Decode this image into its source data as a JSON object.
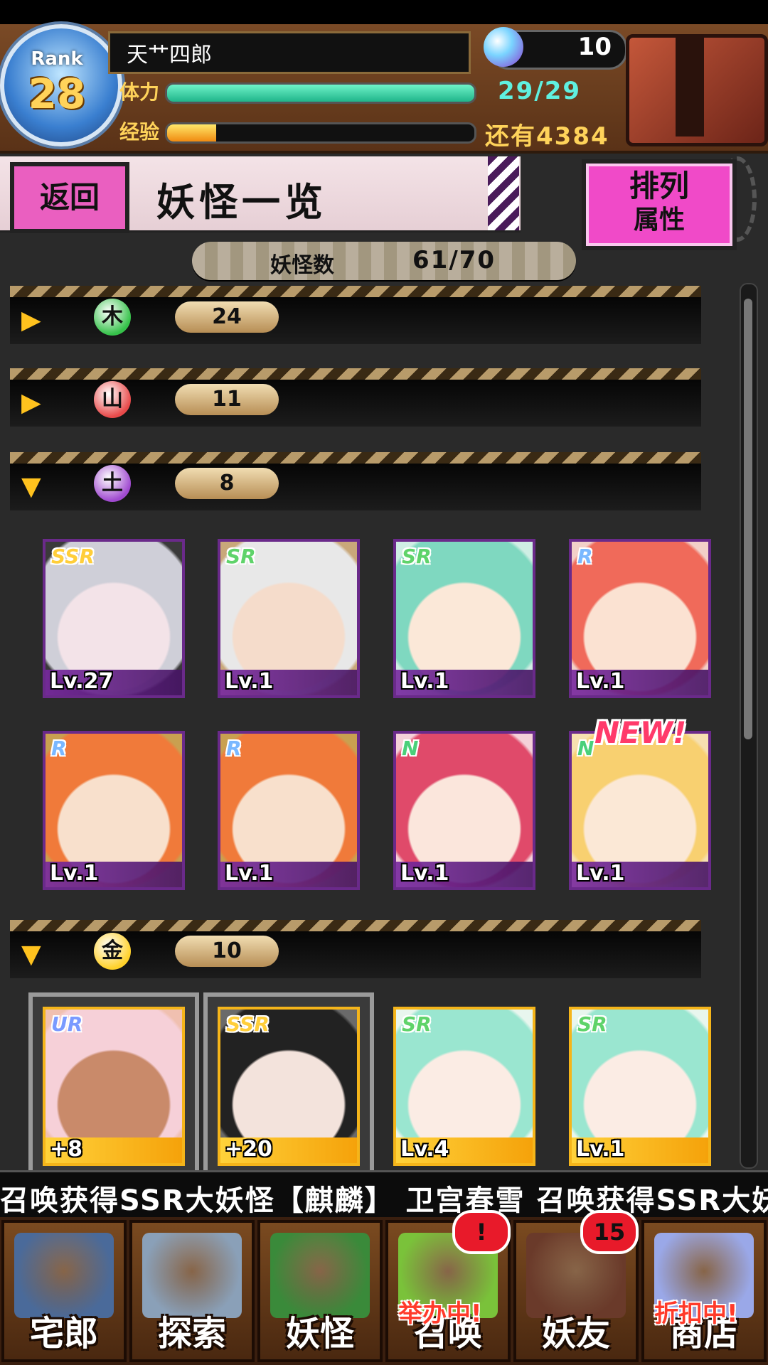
{
  "header": {
    "rank_label": "Rank",
    "rank_value": "28",
    "player_name": "天艹四郎",
    "hp_label": "体力",
    "hp_value": "29/29",
    "hp_fraction": 1.0,
    "exp_label": "经验",
    "exp_remaining": "还有4384",
    "exp_fraction": 0.16,
    "orb_count": "10"
  },
  "titlebar": {
    "back_label": "返回",
    "page_title": "妖怪一览",
    "sort_label_1": "排列",
    "sort_label_2": "属性"
  },
  "count": {
    "label": "妖怪数",
    "value": "61/70"
  },
  "groups": [
    {
      "icon_glyph": "木",
      "count": "24",
      "expanded": false,
      "color": "#36c24a"
    },
    {
      "icon_glyph": "山",
      "count": "11",
      "expanded": false,
      "color": "#e84a4a"
    },
    {
      "icon_glyph": "土",
      "count": "8",
      "expanded": true,
      "color": "#a04ad0"
    },
    {
      "icon_glyph": "金",
      "count": "10",
      "expanded": true,
      "color": "#ffd12a"
    }
  ],
  "cards_group3": [
    {
      "rarity": "SSR",
      "level": "Lv.27",
      "hair": "#cfcfd8",
      "skin": "#f3e3e8",
      "bg": "#3a3a3a"
    },
    {
      "rarity": "SR",
      "level": "Lv.1",
      "hair": "#e8e8e8",
      "skin": "#f5dccb",
      "bg": "#c9a87a"
    },
    {
      "rarity": "SR",
      "level": "Lv.1",
      "hair": "#7fd8c0",
      "skin": "#fbe8d8",
      "bg": "#cfeee4"
    },
    {
      "rarity": "R",
      "level": "Lv.1",
      "hair": "#f06a5a",
      "skin": "#fbe2d2",
      "bg": "#f2d0c8"
    },
    {
      "rarity": "R",
      "level": "Lv.1",
      "hair": "#f07a3a",
      "skin": "#f8e0cc",
      "bg": "#c9a050"
    },
    {
      "rarity": "R",
      "level": "Lv.1",
      "hair": "#f07a3a",
      "skin": "#f8e0cc",
      "bg": "#c9a050"
    },
    {
      "rarity": "N",
      "level": "Lv.1",
      "hair": "#e04a6a",
      "skin": "#fbe6dc",
      "bg": "#f4d0d8"
    },
    {
      "rarity": "N",
      "level": "Lv.1",
      "hair": "#f8d070",
      "skin": "#fbe8d6",
      "bg": "#f6e0b0"
    }
  ],
  "new_badge": "NEW!",
  "cards_group4": [
    {
      "rarity": "UR",
      "level": "+8",
      "hair": "#f6d0d8",
      "skin": "#c98a6a",
      "bg": "#f0c0b0"
    },
    {
      "rarity": "SSR",
      "level": "+20",
      "hair": "#222222",
      "skin": "#f3e3dc",
      "bg": "#6a6a6a"
    },
    {
      "rarity": "SR",
      "level": "Lv.4",
      "hair": "#9ae6d0",
      "skin": "#fbece4",
      "bg": "#e8f6ee"
    },
    {
      "rarity": "SR",
      "level": "Lv.1",
      "hair": "#9ae6d0",
      "skin": "#fbece4",
      "bg": "#e8f6ee"
    }
  ],
  "ticker": "召唤获得SSR大妖怪【麒麟】    卫宫春雪 召唤获得SSR大妖",
  "nav": [
    {
      "label": "宅郎",
      "color": "#4a6a9a"
    },
    {
      "label": "探索",
      "color": "#8aa0b8"
    },
    {
      "label": "妖怪",
      "color": "#3a8a3a"
    },
    {
      "label": "召唤",
      "color": "#7ac23a",
      "tag": "举办中!",
      "badge": "!"
    },
    {
      "label": "妖友",
      "color": "#6a3a2a",
      "badge": "15"
    },
    {
      "label": "商店",
      "color": "#9aa8e8",
      "tag": "折扣中!"
    }
  ]
}
